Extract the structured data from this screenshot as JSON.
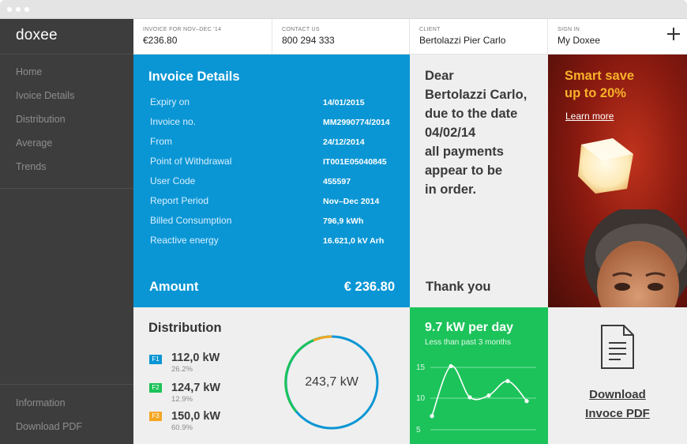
{
  "app": {
    "logo": "doxee"
  },
  "sidebar": {
    "nav": [
      {
        "label": "Home"
      },
      {
        "label": "Ivoice Details"
      },
      {
        "label": "Distribution"
      },
      {
        "label": "Average"
      },
      {
        "label": "Trends"
      }
    ],
    "bottom": [
      {
        "label": "Information"
      },
      {
        "label": "Download PDF"
      }
    ]
  },
  "header": {
    "invoice": {
      "label": "INVOICE FOR NOV–DEC '14",
      "value": "€236.80"
    },
    "contact": {
      "label": "CONTACT US",
      "value": "800 294 333"
    },
    "client": {
      "label": "CLIENT",
      "value": "Bertolazzi Pier Carlo"
    },
    "signin": {
      "label": "SIGN IN",
      "value": "My Doxee"
    }
  },
  "invoice_details": {
    "title": "Invoice Details",
    "rows": [
      {
        "label": "Expiry on",
        "value": "14/01/2015"
      },
      {
        "label": "Invoice no.",
        "value": "MM2990774/2014"
      },
      {
        "label": "From",
        "value": "24/12/2014"
      },
      {
        "label": "Point of Withdrawal",
        "value": "IT001E05040845"
      },
      {
        "label": "User Code",
        "value": "455597"
      },
      {
        "label": "Report Period",
        "value": "Nov–Dec 2014"
      },
      {
        "label": "Billed Consumption",
        "value": "796,9 kWh"
      },
      {
        "label": "Reactive energy",
        "value": "16.621,0 kV Arh"
      }
    ],
    "amount_label": "Amount",
    "amount_value": "€ 236.80"
  },
  "message": {
    "lines": [
      "Dear",
      "Bertolazzi Carlo,",
      "due to the date",
      "04/02/14",
      "all payments",
      "appear to be",
      "in order."
    ],
    "closing": "Thank you"
  },
  "promo": {
    "title_lines": [
      "Smart save",
      "up to 20%"
    ],
    "link": "Learn more",
    "accent_color": "#f8b22a"
  },
  "distribution": {
    "title": "Distribution",
    "total": "243,7 kW",
    "items": [
      {
        "badge": "F1",
        "value": "112,0 kW",
        "percent": "26.2%",
        "color": "#0a96d4"
      },
      {
        "badge": "F2",
        "value": "124,7 kW",
        "percent": "12.9%",
        "color": "#1cc35a"
      },
      {
        "badge": "F3",
        "value": "150,0 kW",
        "percent": "60.9%",
        "color": "#f5a623"
      }
    ]
  },
  "power": {
    "title": "9.7 kW per day",
    "subtitle": "Less than past 3 months",
    "chart_data": {
      "type": "line",
      "y_ticks": [
        "15",
        "10",
        "5"
      ],
      "ylim": [
        5,
        15
      ],
      "points": [
        {
          "x": 0,
          "y": 7.2
        },
        {
          "x": 1,
          "y": 15.2
        },
        {
          "x": 2,
          "y": 10.2
        },
        {
          "x": 3,
          "y": 10.5
        },
        {
          "x": 4,
          "y": 12.8
        },
        {
          "x": 5,
          "y": 9.6
        }
      ]
    }
  },
  "download": {
    "line1": "Download",
    "line2": "Invoce PDF"
  }
}
